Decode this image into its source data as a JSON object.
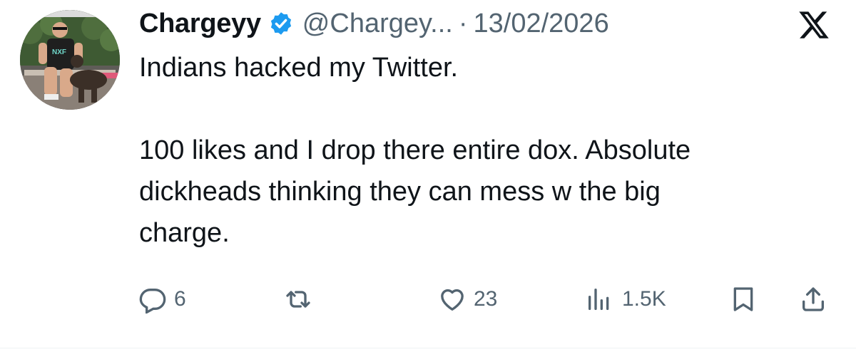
{
  "author": {
    "display_name": "Chargeyy",
    "handle": "@Chargey...",
    "separator": "·",
    "date": "13/02/2026",
    "verified": true,
    "avatar_shirt_text": "NXF"
  },
  "tweet": {
    "line1": "Indians hacked my Twitter.",
    "line2": "100 likes and I drop there entire dox. Absolute\ndickheads thinking they can mess w the big\ncharge."
  },
  "actions": {
    "replies": "6",
    "likes": "23",
    "views": "1.5K"
  },
  "icons": {
    "verified": "verified-badge-icon",
    "brand": "x-logo-icon",
    "reply": "reply-icon",
    "retweet": "retweet-icon",
    "like": "heart-icon",
    "views": "views-icon",
    "bookmark": "bookmark-icon",
    "share": "share-icon"
  },
  "colors": {
    "text": "#0f1419",
    "secondary": "#536471",
    "verified": "#1d9bf0"
  }
}
